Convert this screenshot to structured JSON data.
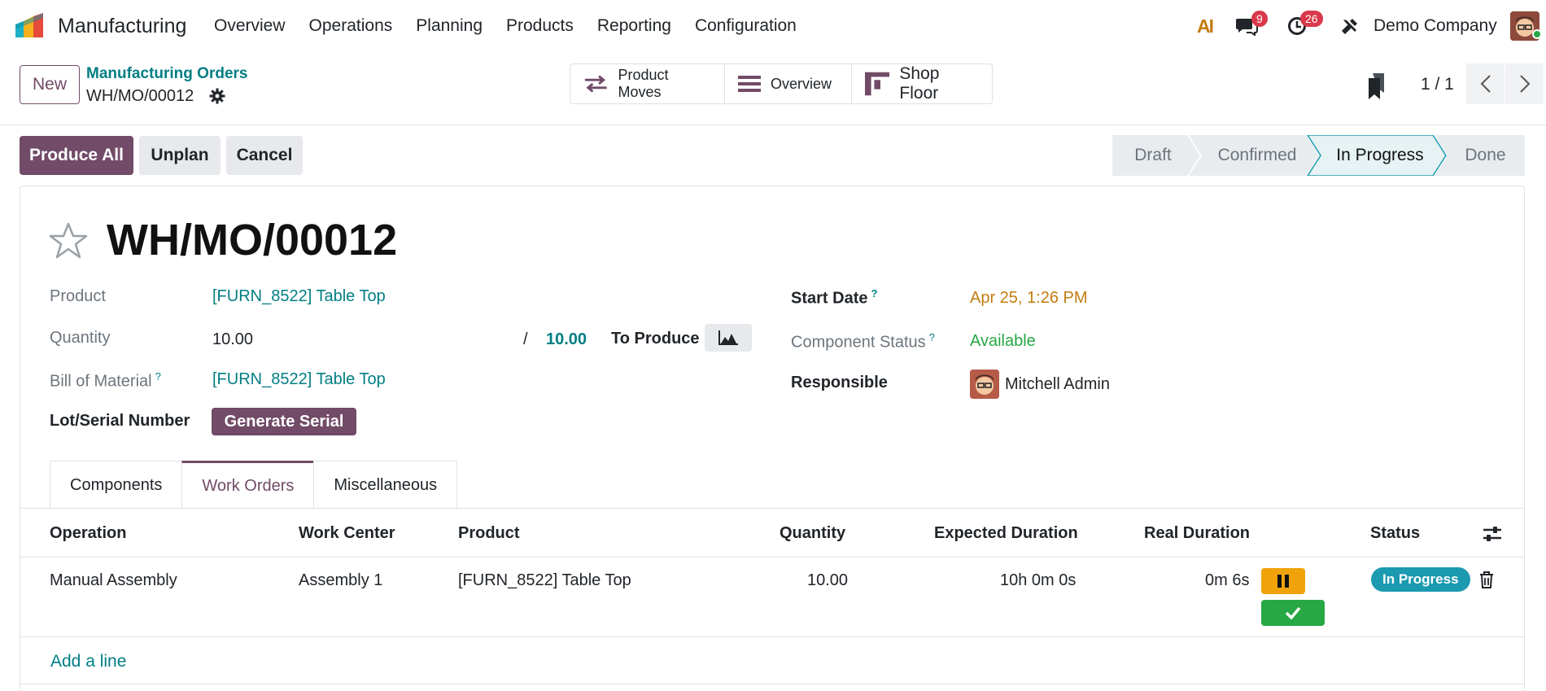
{
  "navbar": {
    "app_name": "Manufacturing",
    "menu": [
      "Overview",
      "Operations",
      "Planning",
      "Products",
      "Reporting",
      "Configuration"
    ],
    "ai_label": "AI",
    "messages_count": "9",
    "activities_count": "26",
    "company": "Demo Company"
  },
  "control_panel": {
    "new_label": "New",
    "breadcrumb_parent": "Manufacturing Orders",
    "breadcrumb_current": "WH/MO/00012",
    "smart_buttons": [
      "Product Moves",
      "Overview",
      "Shop Floor"
    ],
    "pager": "1 / 1"
  },
  "statusbar": {
    "produce_all": "Produce All",
    "unplan": "Unplan",
    "cancel": "Cancel",
    "stages": [
      "Draft",
      "Confirmed",
      "In Progress",
      "Done"
    ],
    "current_stage": "In Progress"
  },
  "form": {
    "title": "WH/MO/00012",
    "product_label": "Product",
    "product": "[FURN_8522] Table Top",
    "quantity_label": "Quantity",
    "quantity": "10.00",
    "slash": "/",
    "quantity_to_produce": "10.00",
    "to_produce_label": "To Produce",
    "bom_label": "Bill of Material",
    "bom": "[FURN_8522] Table Top",
    "lot_label": "Lot/Serial Number",
    "generate_serial": "Generate Serial",
    "start_date_label": "Start Date",
    "start_date": "Apr 25, 1:26 PM",
    "component_status_label": "Component Status",
    "component_status": "Available",
    "responsible_label": "Responsible",
    "responsible": "Mitchell Admin",
    "help_mark": "?"
  },
  "tabs": [
    "Components",
    "Work Orders",
    "Miscellaneous"
  ],
  "active_tab": "Work Orders",
  "work_orders": {
    "columns": [
      "Operation",
      "Work Center",
      "Product",
      "Quantity",
      "Expected Duration",
      "Real Duration",
      "Status"
    ],
    "rows": [
      {
        "operation": "Manual Assembly",
        "work_center": "Assembly 1",
        "product": "[FURN_8522] Table Top",
        "quantity": "10.00",
        "expected_duration": "10h 0m 0s",
        "real_duration": "0m 6s",
        "status": "In Progress"
      }
    ],
    "add_line": "Add a line"
  },
  "colors": {
    "primary": "#714b67",
    "link": "#017e84",
    "accent_orange": "#c27c0e",
    "success": "#28a745",
    "status_pill": "#1b9ab0"
  }
}
